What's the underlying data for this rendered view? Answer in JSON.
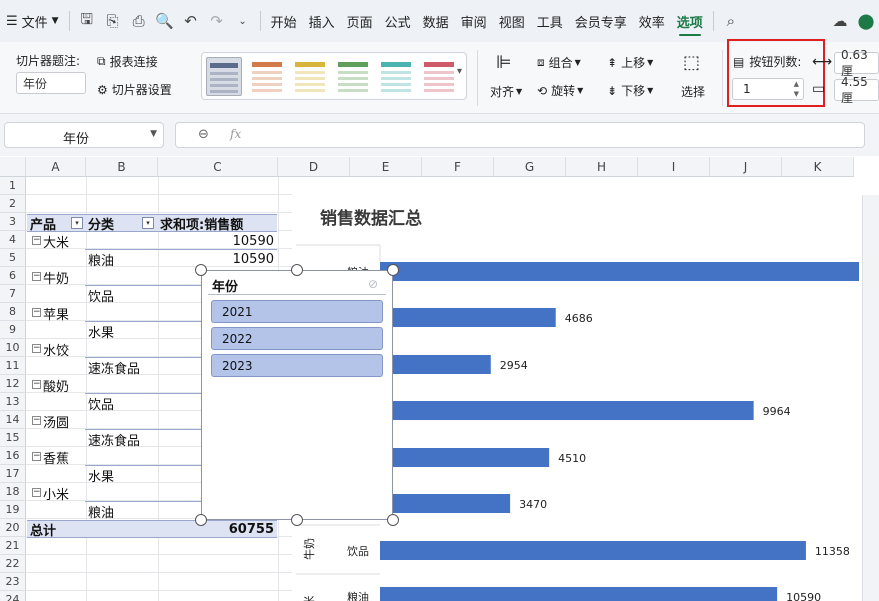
{
  "menubar": {
    "hamburger": "☰",
    "file": "文件",
    "tabs": [
      "开始",
      "插入",
      "页面",
      "公式",
      "数据",
      "审阅",
      "视图",
      "工具",
      "会员专享",
      "效率",
      "选项"
    ],
    "active_tab": "选项"
  },
  "ribbon": {
    "caption_label": "切片器题注:",
    "caption_value": "年份",
    "report_connections": "报表连接",
    "slicer_settings": "切片器设置",
    "align": "对齐",
    "group": "组合",
    "rotate": "旋转",
    "bring_forward": "上移",
    "send_backward": "下移",
    "select": "选择",
    "button_columns_label": "按钮列数:",
    "button_columns_value": "1",
    "width_value": "0.63厘",
    "height_value": "4.55厘"
  },
  "formula_bar": {
    "name_box": "年份",
    "fx": "fx"
  },
  "columns": [
    "A",
    "B",
    "C",
    "D",
    "E",
    "F",
    "G",
    "H",
    "I",
    "J",
    "K"
  ],
  "rows": [
    "1",
    "2",
    "3",
    "4",
    "5",
    "6",
    "7",
    "8",
    "9",
    "10",
    "11",
    "12",
    "13",
    "14",
    "15",
    "16",
    "17",
    "18",
    "19",
    "20",
    "21",
    "22",
    "23",
    "24"
  ],
  "pivot": {
    "header_product": "产品",
    "header_category": "分类",
    "header_sum": "求和项:销售额",
    "rows": [
      {
        "product": "大米",
        "category": "粮油",
        "value": "10590",
        "category_value": "10590"
      },
      {
        "product": "牛奶",
        "category": "饮品",
        "value": "",
        "category_value": ""
      },
      {
        "product": "苹果",
        "category": "水果",
        "value": "",
        "category_value": ""
      },
      {
        "product": "水饺",
        "category": "速冻食品",
        "value": "",
        "category_value": ""
      },
      {
        "product": "酸奶",
        "category": "饮品",
        "value": "",
        "category_value": ""
      },
      {
        "product": "汤圆",
        "category": "速冻食品",
        "value": "",
        "category_value": ""
      },
      {
        "product": "香蕉",
        "category": "水果",
        "value": "",
        "category_value": ""
      },
      {
        "product": "小米",
        "category": "粮油",
        "value": "",
        "category_value": ""
      }
    ],
    "total_label": "总计",
    "total_value": "60755"
  },
  "slicer": {
    "title": "年份",
    "items": [
      "2021",
      "2022",
      "2023"
    ]
  },
  "chart_data": {
    "type": "bar",
    "title": "销售数据汇总",
    "orientation": "horizontal",
    "bars": [
      {
        "category": "粮油",
        "group": "米",
        "value": null
      },
      {
        "category": "",
        "group": "",
        "value": 4686
      },
      {
        "category": "",
        "group": "",
        "value": 2954
      },
      {
        "category": "",
        "group": "",
        "value": 9964
      },
      {
        "category": "",
        "group": "",
        "value": 4510
      },
      {
        "category": "",
        "group": "",
        "value": 3470
      },
      {
        "category": "饮品",
        "group": "牛奶",
        "value": 11358
      },
      {
        "category": "粮油",
        "group": "米",
        "value": 10590
      }
    ],
    "bar_color": "#4472c4",
    "grid": false
  },
  "colors": {
    "accent": "#1d7a46",
    "pivot_band": "#dde3f2",
    "slicer_button": "#b4c3e8",
    "highlight_box": "#e02020"
  }
}
